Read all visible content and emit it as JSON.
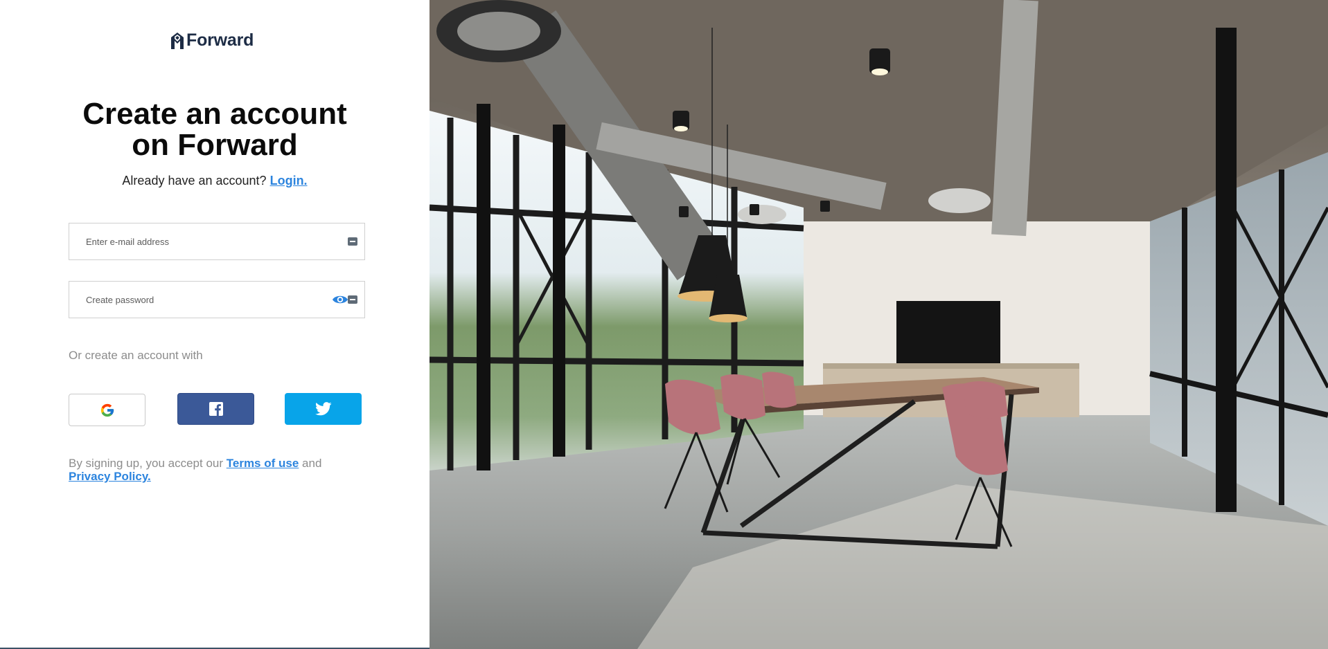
{
  "brand": {
    "name": "Forward",
    "logo_icon": "forward-logo-icon"
  },
  "heading": {
    "line1": "Create an account",
    "line2": "on Forward"
  },
  "login_prompt": {
    "text": "Already have an account? ",
    "link": "Login."
  },
  "form": {
    "email_placeholder": "Enter e-mail address",
    "password_placeholder": "Create password"
  },
  "social": {
    "label": "Or create an account with",
    "buttons": [
      {
        "name": "google",
        "icon": "google-icon"
      },
      {
        "name": "facebook",
        "icon": "facebook-icon",
        "color": "#3b5998"
      },
      {
        "name": "twitter",
        "icon": "twitter-icon",
        "color": "#08a4e9"
      }
    ]
  },
  "terms": {
    "prefix": "By signing up, you accept our ",
    "terms_link": "Terms of use",
    "middle": " and",
    "privacy_link": "Privacy Policy."
  },
  "colors": {
    "link": "#2c84de",
    "brand_text": "#1d2c45",
    "facebook": "#3b5998",
    "twitter": "#08a4e9"
  }
}
